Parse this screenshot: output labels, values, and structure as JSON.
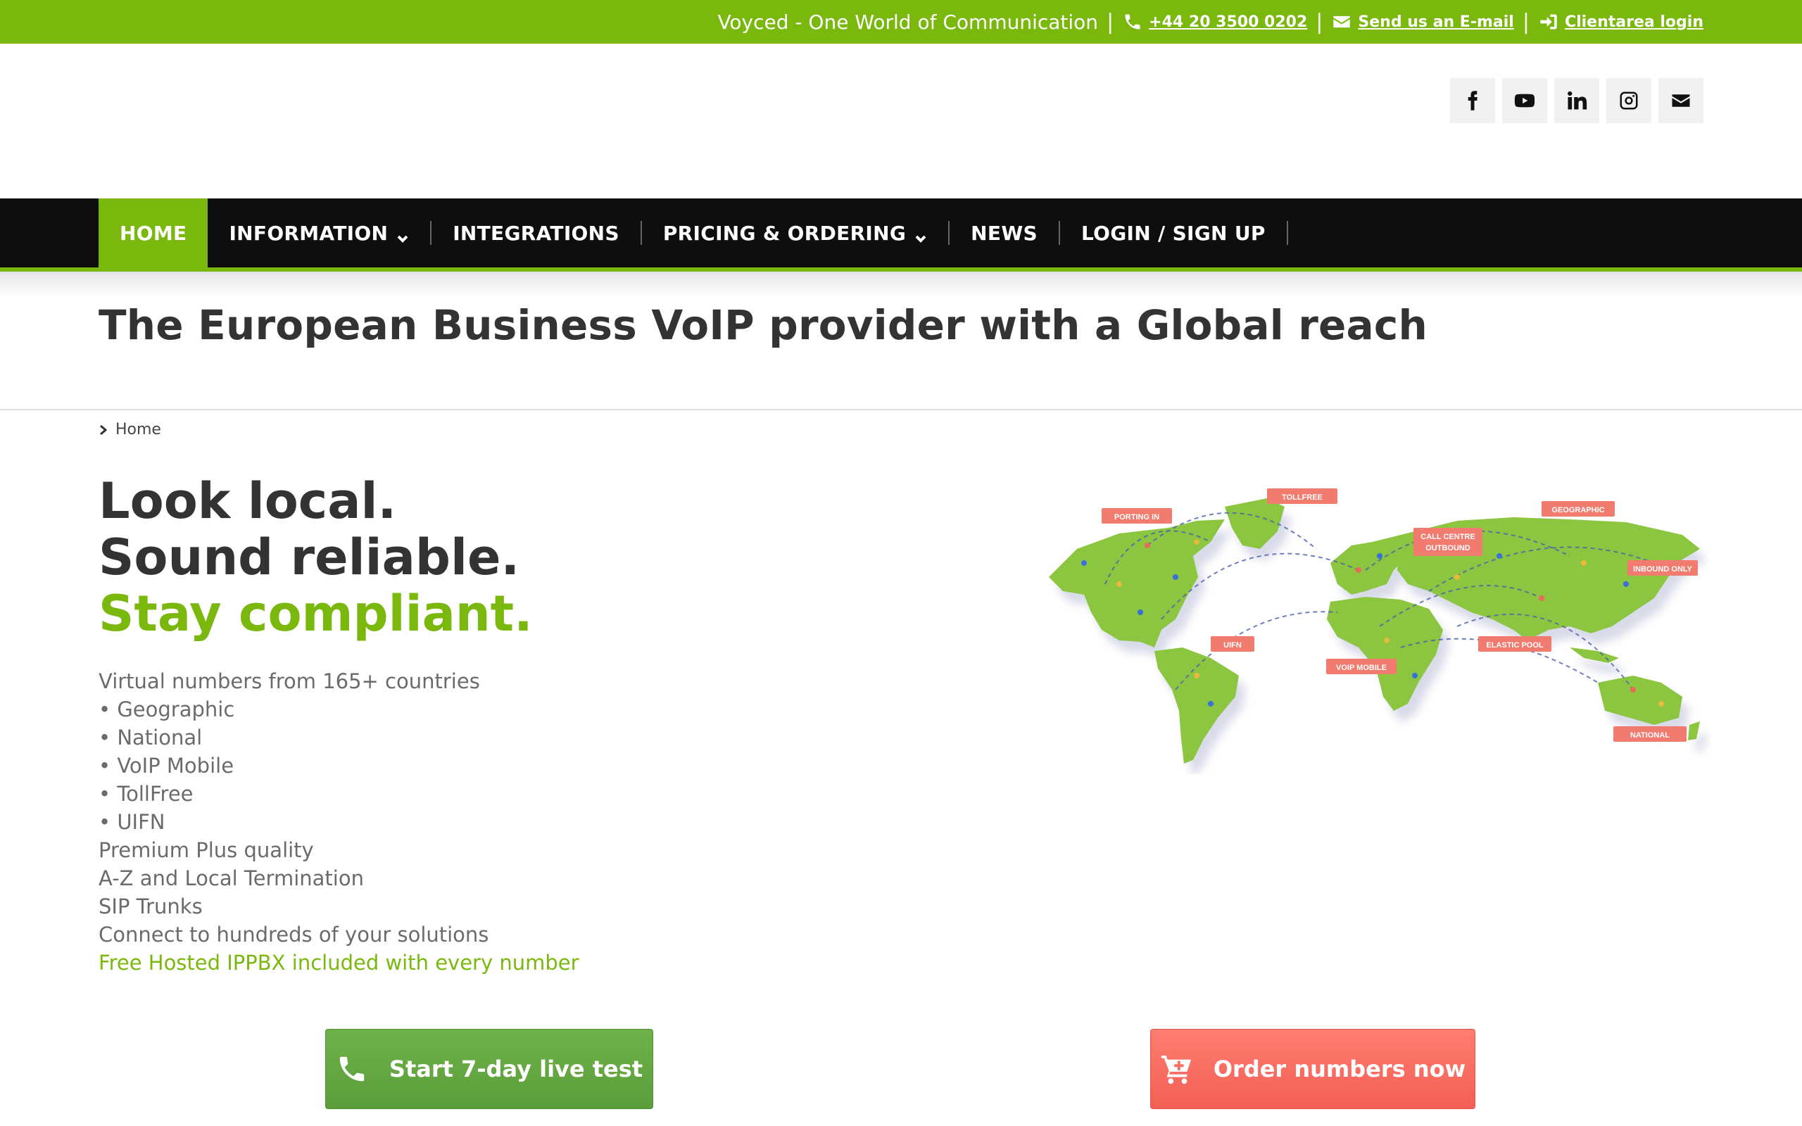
{
  "topbar": {
    "tagline": "Voyced - One World of Communication",
    "separator": "|",
    "phone": "+44 20 3500 0202",
    "email_link": "Send us an E-mail",
    "client_login": "Clientarea login",
    "bg_color": "#7ab80e"
  },
  "social": [
    "facebook-icon",
    "youtube-icon",
    "linkedin-icon",
    "instagram-icon",
    "envelope-icon"
  ],
  "nav": {
    "items": [
      {
        "label": "HOME",
        "active": true
      },
      {
        "label": "INFORMATION",
        "dropdown": true
      },
      {
        "label": "INTEGRATIONS"
      },
      {
        "label": "PRICING & ORDERING",
        "dropdown": true
      },
      {
        "label": "NEWS"
      },
      {
        "label": "LOGIN / SIGN UP"
      }
    ]
  },
  "page_title": "The European Business VoIP provider with a Global reach",
  "breadcrumb": {
    "home": "Home"
  },
  "headline": {
    "line1": "Look local.",
    "line2": "Sound reliable.",
    "line3": "Stay compliant."
  },
  "features": [
    "Virtual numbers from 165+ countries",
    "• Geographic",
    "• National",
    "• VoIP Mobile",
    "• TollFree",
    "• UIFN",
    "Premium Plus quality",
    "A-Z and Local Termination",
    "SIP Trunks",
    "Connect to hundreds of your solutions",
    "Free Hosted IPPBX included with every number"
  ],
  "map": {
    "labels": [
      "TOLLFREE",
      "PORTING IN",
      "GEOGRAPHIC",
      "CALL CENTRE",
      "OUTBOUND",
      "INBOUND ONLY",
      "UIFN",
      "ELASTIC POOL",
      "VOIP MOBILE",
      "NATIONAL"
    ]
  },
  "cta": {
    "test_label": "Start 7-day live test",
    "order_label": "Order numbers now"
  },
  "colors": {
    "accent": "#7ab80e",
    "nav_bg": "#0e0e0e",
    "cta_green": "#63a842",
    "cta_red": "#f8695e"
  }
}
